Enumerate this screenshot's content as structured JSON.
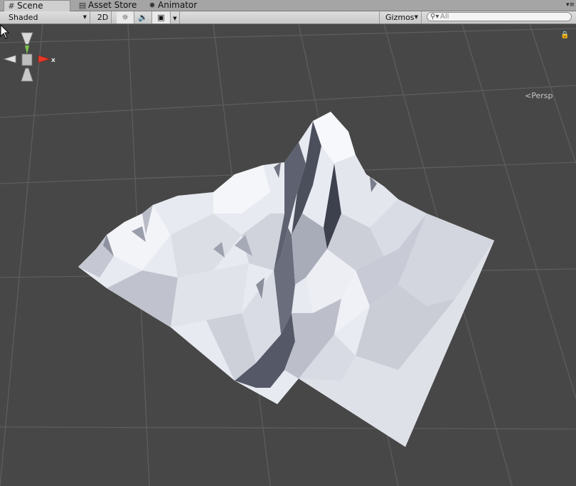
{
  "tabs": [
    {
      "label": "Scene",
      "icon": "grid-icon",
      "active": true
    },
    {
      "label": "Asset Store",
      "icon": "bag-icon",
      "active": false
    },
    {
      "label": "Animator",
      "icon": "animator-icon",
      "active": false
    }
  ],
  "toolbar": {
    "draw_mode": "Shaded",
    "mode_2d": "2D",
    "lighting_icon": "sun-icon",
    "audio_icon": "speaker-icon",
    "effects_icon": "image-icon",
    "gizmos_label": "Gizmos",
    "search_placeholder": "All"
  },
  "scene": {
    "projection": "Persp",
    "axis_x_label": "x",
    "background_color": "#474747",
    "terrain_color": "#e6e8f0"
  }
}
